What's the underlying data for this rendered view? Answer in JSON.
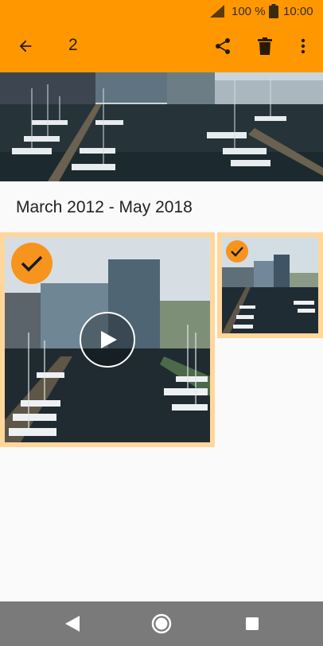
{
  "status_bar": {
    "battery_text": "100 %",
    "time": "10:00",
    "icons": [
      "signal-icon",
      "battery-icon"
    ]
  },
  "app_bar": {
    "selected_count": "2",
    "icons": [
      "back-arrow-icon",
      "share-icon",
      "delete-icon",
      "more-vert-icon"
    ]
  },
  "section": {
    "title": "March 2012 - May 2018"
  },
  "items": [
    {
      "type": "video",
      "selected": true
    },
    {
      "type": "photo",
      "selected": true
    }
  ],
  "nav_bar": {
    "icons": [
      "nav-back-icon",
      "nav-home-icon",
      "nav-recents-icon"
    ]
  },
  "colors": {
    "accent": "#ff9800",
    "selection_border": "#ffd79a",
    "check_badge": "#f7941d",
    "nav_bar": "#7a7a7a"
  }
}
